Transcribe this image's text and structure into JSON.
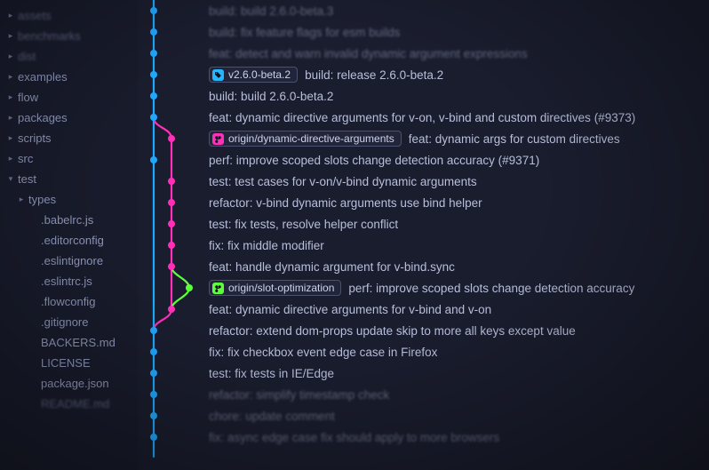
{
  "colors": {
    "lane_main": "#1fa8ff",
    "lane_magenta": "#ff2fb9",
    "lane_green": "#5dff3b"
  },
  "sidebar": {
    "items": [
      {
        "label": "assets",
        "expand": "right",
        "indent": 0,
        "faded": true
      },
      {
        "label": "benchmarks",
        "expand": "right",
        "indent": 0,
        "faded": true
      },
      {
        "label": "dist",
        "expand": "right",
        "indent": 0,
        "faded": true
      },
      {
        "label": "examples",
        "expand": "right",
        "indent": 0,
        "faded": false
      },
      {
        "label": "flow",
        "expand": "right",
        "indent": 0,
        "faded": false
      },
      {
        "label": "packages",
        "expand": "right",
        "indent": 0,
        "faded": false
      },
      {
        "label": "scripts",
        "expand": "right",
        "indent": 0,
        "faded": false
      },
      {
        "label": "src",
        "expand": "right",
        "indent": 0,
        "faded": false
      },
      {
        "label": "test",
        "expand": "down",
        "indent": 0,
        "faded": false
      },
      {
        "label": "types",
        "expand": "right",
        "indent": 1,
        "faded": false
      },
      {
        "label": ".babelrc.js",
        "expand": "none",
        "indent": 2,
        "faded": false
      },
      {
        "label": ".editorconfig",
        "expand": "none",
        "indent": 2,
        "faded": false
      },
      {
        "label": ".eslintignore",
        "expand": "none",
        "indent": 2,
        "faded": false
      },
      {
        "label": ".eslintrc.js",
        "expand": "none",
        "indent": 2,
        "faded": false
      },
      {
        "label": ".flowconfig",
        "expand": "none",
        "indent": 2,
        "faded": false
      },
      {
        "label": ".gitignore",
        "expand": "none",
        "indent": 2,
        "faded": false
      },
      {
        "label": "BACKERS.md",
        "expand": "none",
        "indent": 2,
        "faded": false
      },
      {
        "label": "LICENSE",
        "expand": "none",
        "indent": 2,
        "faded": false
      },
      {
        "label": "package.json",
        "expand": "none",
        "indent": 2,
        "faded": false
      },
      {
        "label": "README.md",
        "expand": "none",
        "indent": 2,
        "faded": true
      }
    ]
  },
  "commits": [
    {
      "message": "build: build 2.6.0-beta.3",
      "lane": "main",
      "faded": true
    },
    {
      "message": "build: fix feature flags for esm builds",
      "lane": "main",
      "faded": true
    },
    {
      "message": "feat: detect and warn invalid dynamic argument expressions",
      "lane": "main",
      "faded": true
    },
    {
      "tag": {
        "label": "v2.6.0-beta.2",
        "color": "blue",
        "icon": "tag"
      },
      "after_tag": "build: release 2.6.0-beta.2",
      "lane": "main",
      "faded": false
    },
    {
      "message": "build: build 2.6.0-beta.2",
      "lane": "main",
      "faded": false
    },
    {
      "message": "feat: dynamic directive arguments for v-on, v-bind and custom directives (#9373)",
      "lane": "main",
      "faded": false
    },
    {
      "tag": {
        "label": "origin/dynamic-directive-arguments",
        "color": "magenta",
        "icon": "branch"
      },
      "after_tag": "feat: dynamic args for custom directives",
      "lane": "magenta",
      "faded": false
    },
    {
      "message": "perf: improve scoped slots change detection accuracy (#9371)",
      "lane": "main",
      "faded": false
    },
    {
      "message": "test: test cases for v-on/v-bind dynamic arguments",
      "lane": "magenta",
      "faded": false
    },
    {
      "message": "refactor: v-bind dynamic arguments use bind helper",
      "lane": "magenta",
      "faded": false
    },
    {
      "message": "test: fix tests, resolve helper conflict",
      "lane": "magenta",
      "faded": false
    },
    {
      "message": "fix: fix middle modifier",
      "lane": "magenta",
      "faded": false
    },
    {
      "message": "feat: handle dynamic argument for v-bind.sync",
      "lane": "magenta",
      "faded": false
    },
    {
      "tag": {
        "label": "origin/slot-optimization",
        "color": "green",
        "icon": "branch"
      },
      "after_tag": "perf: improve scoped slots change detection accuracy",
      "lane": "green",
      "faded": false
    },
    {
      "message": "feat: dynamic directive arguments for v-bind and v-on",
      "lane": "magenta",
      "faded": false
    },
    {
      "message": "refactor: extend dom-props update skip to more all keys except value",
      "lane": "main",
      "faded": false
    },
    {
      "message": "fix: fix checkbox event edge case in Firefox",
      "lane": "main",
      "faded": false
    },
    {
      "message": "test: fix tests in IE/Edge",
      "lane": "main",
      "faded": false
    },
    {
      "message": "refactor: simplify timestamp check",
      "lane": "main",
      "faded": true
    },
    {
      "message": "chore: update comment",
      "lane": "main",
      "faded": true
    },
    {
      "message": "fix: async edge case fix should apply to more browsers",
      "lane": "main",
      "faded": true
    }
  ]
}
